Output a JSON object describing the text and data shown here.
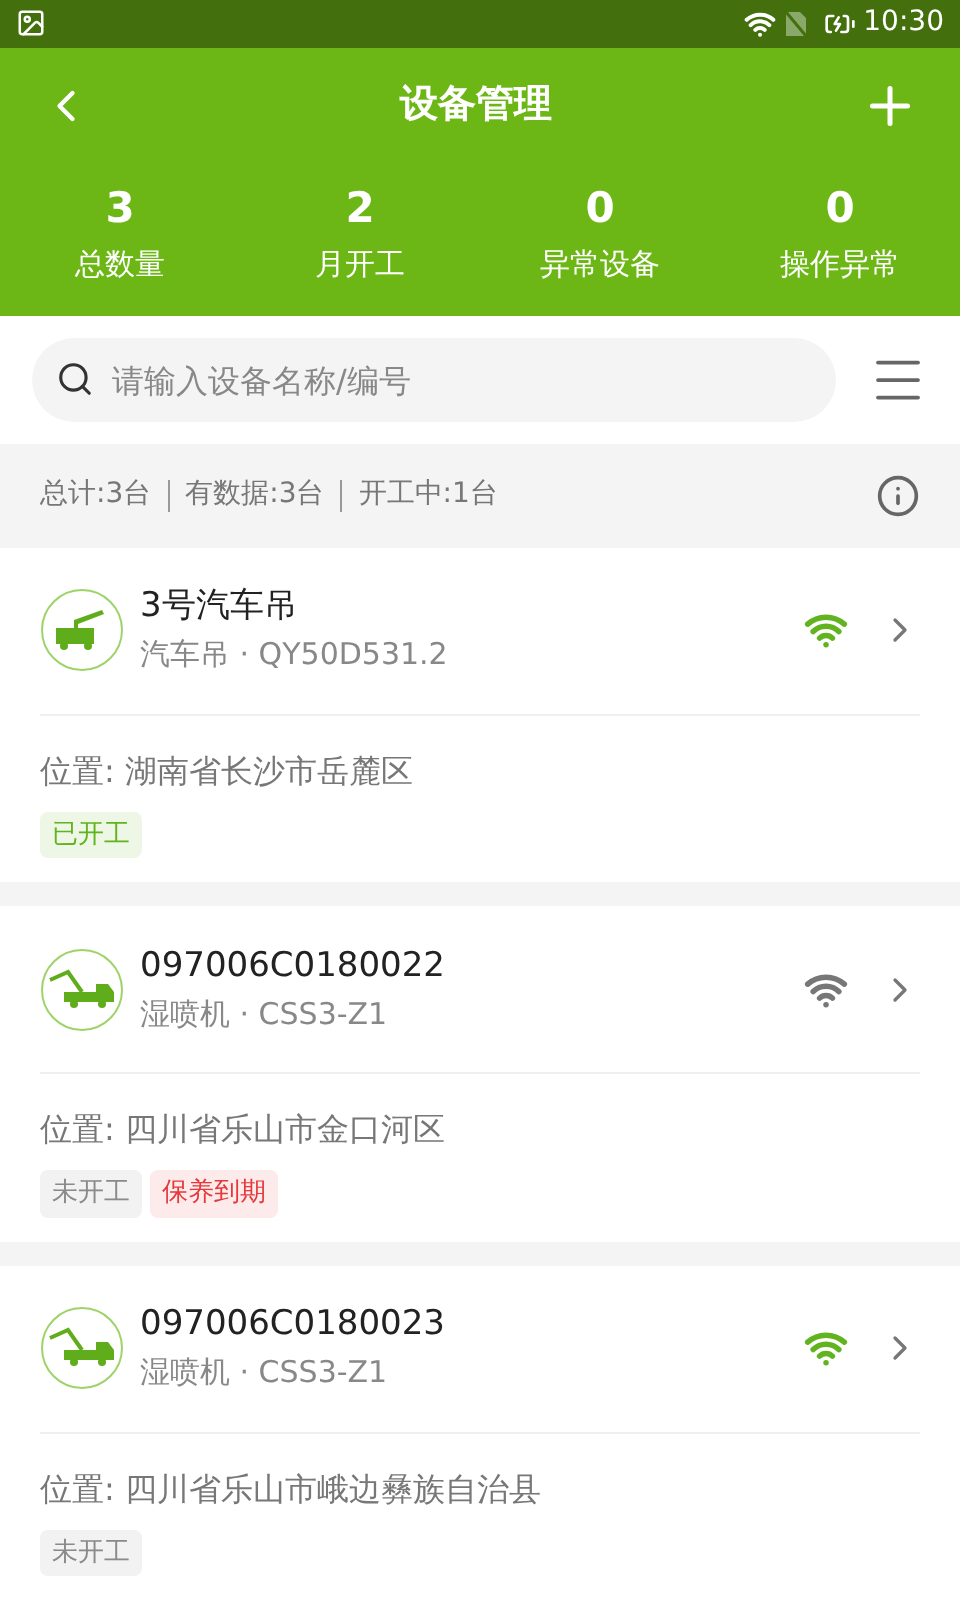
{
  "status_bar": {
    "time": "10:30"
  },
  "header": {
    "title": "设备管理"
  },
  "stats": [
    {
      "value": "3",
      "label": "总数量"
    },
    {
      "value": "2",
      "label": "月开工"
    },
    {
      "value": "0",
      "label": "异常设备"
    },
    {
      "value": "0",
      "label": "操作异常"
    }
  ],
  "search": {
    "placeholder": "请输入设备名称/编号"
  },
  "summary": {
    "items": [
      "总计:3台",
      "有数据:3台",
      "开工中:1台"
    ]
  },
  "devices": [
    {
      "name": "3号汽车吊",
      "kind": "crane",
      "subtitle": "汽车吊 · QY50D531.2",
      "online": true,
      "location": "位置: 湖南省长沙市岳麓区",
      "tags": [
        {
          "label": "已开工",
          "kind": "working"
        }
      ]
    },
    {
      "name": "097006C0180022",
      "kind": "sprayer",
      "subtitle": "湿喷机 · CSS3-Z1",
      "online": false,
      "location": "位置: 四川省乐山市金口河区",
      "tags": [
        {
          "label": "未开工",
          "kind": "idle"
        },
        {
          "label": "保养到期",
          "kind": "alert"
        }
      ]
    },
    {
      "name": "097006C0180023",
      "kind": "sprayer",
      "subtitle": "湿喷机 · CSS3-Z1",
      "online": true,
      "location": "位置: 四川省乐山市峨边彝族自治县",
      "tags": [
        {
          "label": "未开工",
          "kind": "idle"
        }
      ]
    }
  ]
}
